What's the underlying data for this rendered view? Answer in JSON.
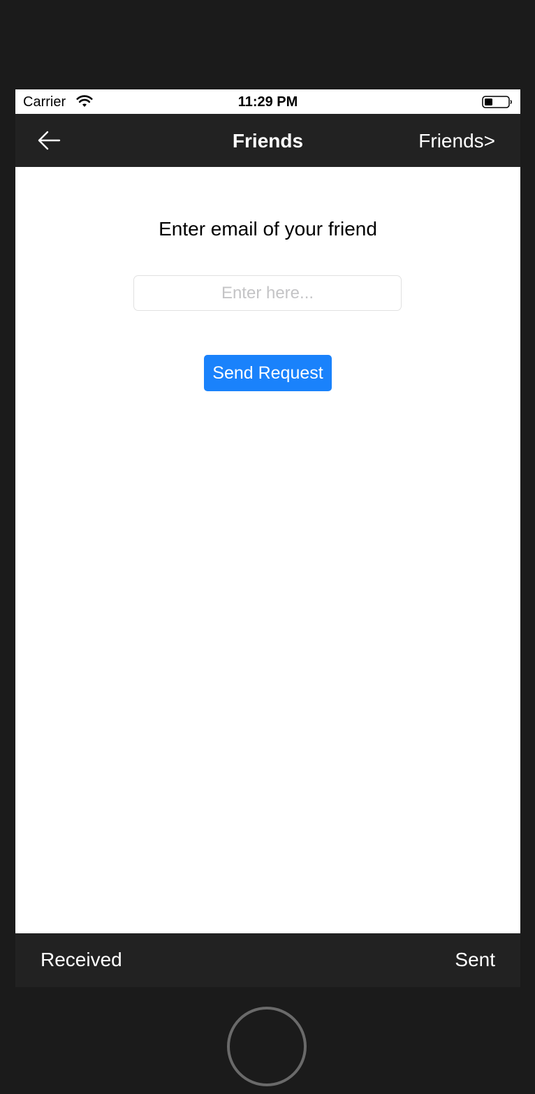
{
  "status_bar": {
    "carrier": "Carrier",
    "time": "11:29 PM",
    "wifi_icon": "wifi-icon",
    "battery_icon": "battery-icon"
  },
  "nav": {
    "back_icon": "back-arrow-icon",
    "title": "Friends",
    "right_link": "Friends>"
  },
  "form": {
    "prompt": "Enter email of your friend",
    "email_value": "",
    "email_placeholder": "Enter here...",
    "send_label": "Send Request"
  },
  "tabs": {
    "received": "Received",
    "sent": "Sent"
  },
  "colors": {
    "nav_background": "#222222",
    "primary_button": "#1a82fb",
    "device_frame": "#1b1b1b"
  }
}
